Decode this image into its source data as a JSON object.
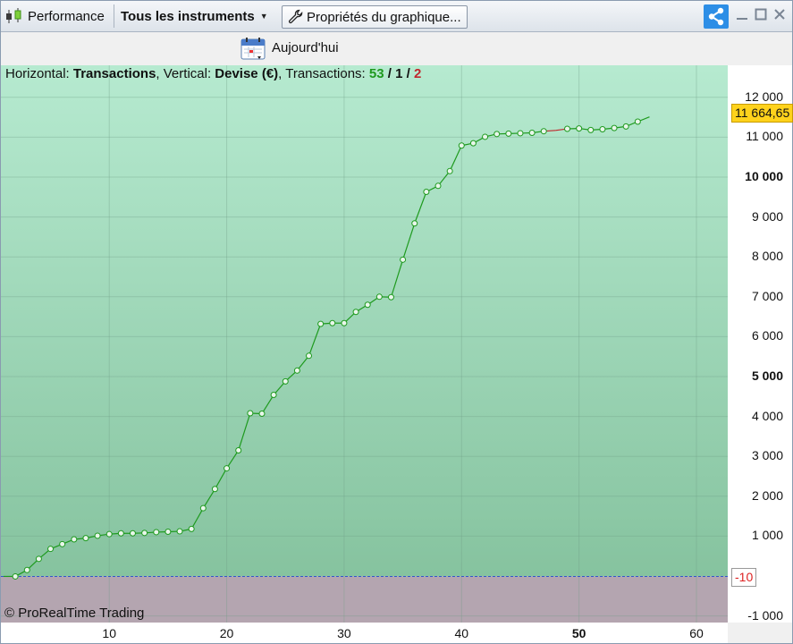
{
  "toolbar": {
    "performance_label": "Performance",
    "instruments_label": "Tous les instruments",
    "properties_label": "Propriétés du graphique...",
    "icons": [
      "candlestick-icon",
      "wrench-icon",
      "share-icon",
      "minimize-icon",
      "maximize-icon",
      "close-icon"
    ]
  },
  "subbar": {
    "today_label": "Aujourd'hui",
    "icon": "calendar-icon"
  },
  "info": {
    "horizontal_prefix": "Horizontal: ",
    "horizontal_value": "Transactions",
    "vertical_prefix": ", Vertical: ",
    "vertical_value": "Devise (€)",
    "transactions_prefix": ", Transactions: ",
    "winning": "53",
    "slash1": " / ",
    "neutral": "1",
    "slash2": " / ",
    "losing": "2"
  },
  "copyright": "© ProRealTime Trading",
  "last_value_label": "11 664,65",
  "zero_label": "-10",
  "colors": {
    "gain_area": "#8cc9a6",
    "loss_area": "#b4a5b0",
    "line": "#1e9a1e",
    "loss_line": "#c0282d",
    "last_value_bg": "#ffd21c"
  },
  "chart_data": {
    "type": "line",
    "x": [
      1,
      2,
      3,
      4,
      5,
      6,
      7,
      8,
      9,
      10,
      11,
      12,
      13,
      14,
      15,
      16,
      17,
      18,
      19,
      20,
      21,
      22,
      23,
      24,
      25,
      26,
      27,
      28,
      29,
      30,
      31,
      32,
      33,
      34,
      35,
      36,
      37,
      38,
      39,
      40,
      41,
      42,
      43,
      44,
      45,
      46,
      47,
      48,
      49,
      50,
      51,
      52,
      53,
      54,
      55,
      56
    ],
    "y": [
      -10,
      -10,
      150,
      430,
      680,
      800,
      920,
      950,
      1010,
      1050,
      1070,
      1070,
      1080,
      1100,
      1110,
      1120,
      1180,
      1700,
      2180,
      2700,
      3150,
      4080,
      4070,
      4540,
      4880,
      5150,
      5520,
      6320,
      6340,
      6340,
      6620,
      6800,
      7000,
      6990,
      7930,
      8840,
      9630,
      9780,
      10150,
      10790,
      10850,
      11010,
      11080,
      11090,
      11100,
      11110,
      11150,
      11170,
      11210,
      11220,
      11180,
      11200,
      11230,
      11270,
      11390,
      11510,
      11600,
      11660
    ],
    "ylim": [
      -1200,
      12500
    ],
    "xlim": [
      1,
      63
    ],
    "yticks": [
      -1000,
      1000,
      2000,
      3000,
      4000,
      5000,
      6000,
      7000,
      8000,
      9000,
      10000,
      11000,
      12000
    ],
    "ytick_labels": [
      "-1 000",
      "1 000",
      "2 000",
      "3 000",
      "4 000",
      "5 000",
      "6 000",
      "7 000",
      "8 000",
      "9 000",
      "10 000",
      "11 000",
      "12 000"
    ],
    "ytick_bold": [
      5000,
      10000
    ],
    "xticks": [
      10,
      20,
      30,
      40,
      50,
      60
    ],
    "xtick_labels": [
      "10",
      "20",
      "30",
      "40",
      "50",
      "60"
    ],
    "xtick_bold": [
      50
    ],
    "loss_segments": [
      [
        47,
        49
      ]
    ],
    "grid": true,
    "baseline": -10
  }
}
